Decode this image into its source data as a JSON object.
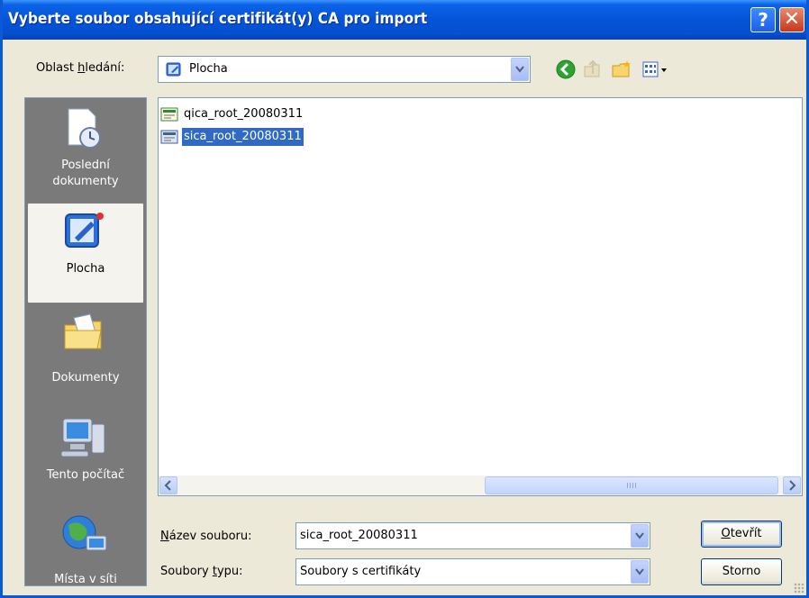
{
  "window": {
    "title": "Vyberte soubor obsahující certifikát(y) CA pro import",
    "help_label": "?",
    "close_label": "✕"
  },
  "lookin": {
    "label": "Oblast hledání:",
    "value": "Plocha"
  },
  "toolbar": {
    "icons": [
      "back-icon",
      "up-folder-icon",
      "new-folder-icon",
      "view-menu-icon"
    ]
  },
  "places": [
    {
      "label_line1": "Poslední",
      "label_line2": "dokumenty",
      "icon": "recent-documents-icon"
    },
    {
      "label_line1": "Plocha",
      "label_line2": "",
      "icon": "desktop-icon",
      "selected": true
    },
    {
      "label_line1": "Dokumenty",
      "label_line2": "",
      "icon": "my-documents-icon"
    },
    {
      "label_line1": "Tento počítač",
      "label_line2": "",
      "icon": "my-computer-icon"
    },
    {
      "label_line1": "Místa v síti",
      "label_line2": "",
      "icon": "network-places-icon"
    }
  ],
  "files": [
    {
      "name": "qica_root_20080311",
      "selected": false,
      "icon": "certificate-icon"
    },
    {
      "name": "sica_root_20080311",
      "selected": true,
      "icon": "certificate-icon"
    }
  ],
  "filename": {
    "label": "Název souboru:",
    "value": "sica_root_20080311"
  },
  "filetype": {
    "label": "Soubory typu:",
    "value": "Soubory s certifikáty"
  },
  "buttons": {
    "open": "Otevřít",
    "cancel": "Storno"
  }
}
